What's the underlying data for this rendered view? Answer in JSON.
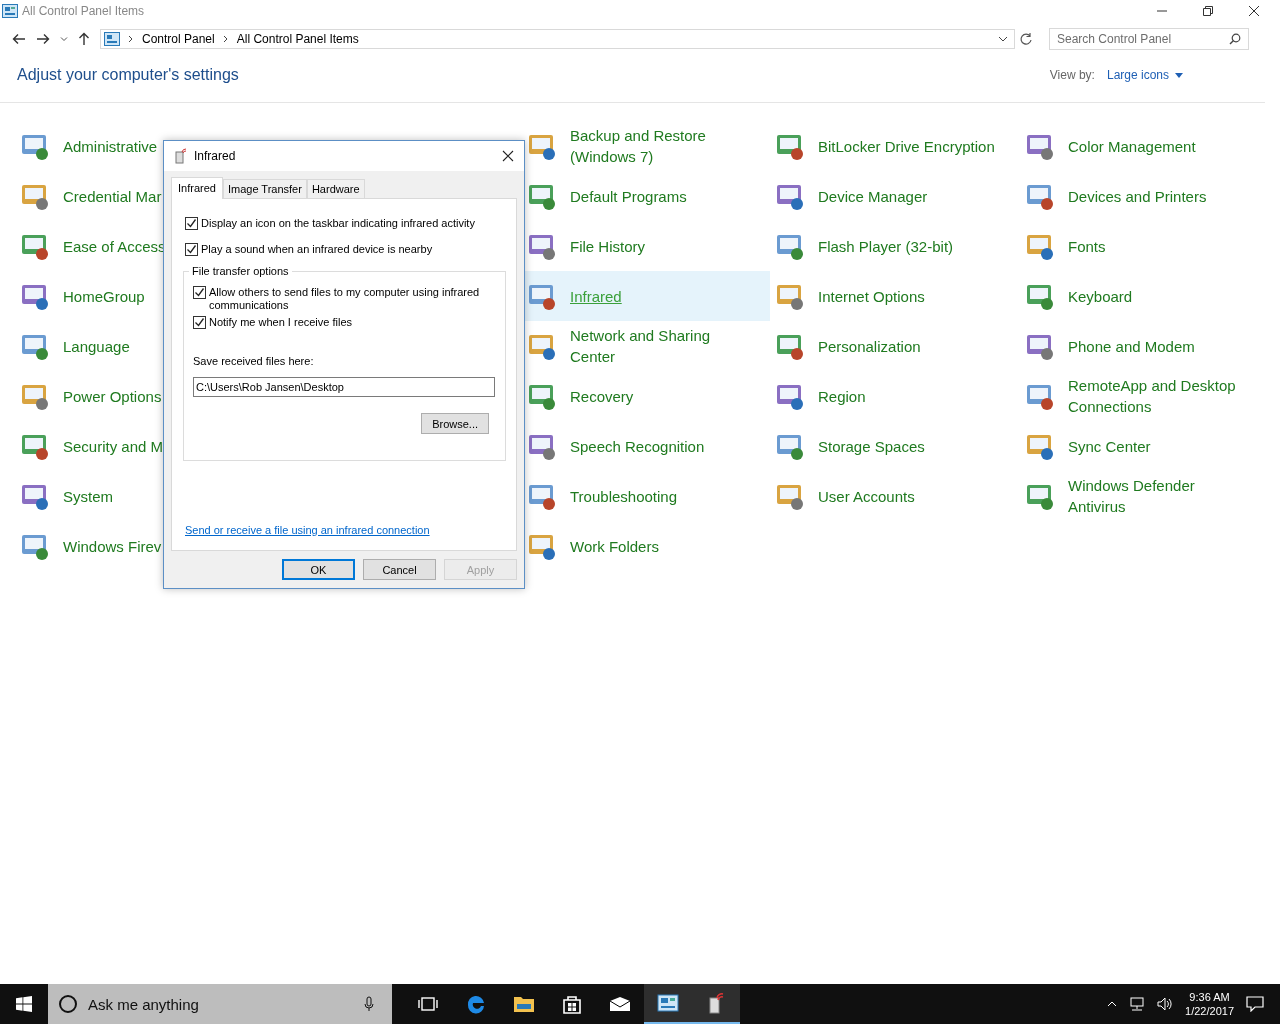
{
  "window": {
    "title": "All Control Panel Items"
  },
  "address": {
    "crumbs": [
      "Control Panel",
      "All Control Panel Items"
    ],
    "search_placeholder": "Search Control Panel"
  },
  "header": {
    "title": "Adjust your computer's settings",
    "view_by_label": "View by:",
    "view_by_value": "Large icons"
  },
  "columns": [
    {
      "items": [
        {
          "label": "Administrative",
          "selected": false
        },
        {
          "label": "Credential Mar",
          "selected": false
        },
        {
          "label": "Ease of Access",
          "selected": false
        },
        {
          "label": "HomeGroup",
          "selected": false
        },
        {
          "label": "Language",
          "selected": false
        },
        {
          "label": "Power Options",
          "selected": false
        },
        {
          "label": "Security and M",
          "selected": false
        },
        {
          "label": "System",
          "selected": false
        },
        {
          "label": "Windows Firev",
          "selected": false
        }
      ]
    },
    {
      "items": [
        {
          "label": "Backup and Restore (Windows 7)",
          "selected": false
        },
        {
          "label": "Default Programs",
          "selected": false
        },
        {
          "label": "File History",
          "selected": false
        },
        {
          "label": "Infrared",
          "selected": true
        },
        {
          "label": "Network and Sharing Center",
          "selected": false
        },
        {
          "label": "Recovery",
          "selected": false
        },
        {
          "label": "Speech Recognition",
          "selected": false
        },
        {
          "label": "Troubleshooting",
          "selected": false
        },
        {
          "label": "Work Folders",
          "selected": false
        }
      ]
    },
    {
      "items": [
        {
          "label": "BitLocker Drive Encryption",
          "selected": false
        },
        {
          "label": "Device Manager",
          "selected": false
        },
        {
          "label": "Flash Player (32-bit)",
          "selected": false
        },
        {
          "label": "Internet Options",
          "selected": false
        },
        {
          "label": "Personalization",
          "selected": false
        },
        {
          "label": "Region",
          "selected": false
        },
        {
          "label": "Storage Spaces",
          "selected": false
        },
        {
          "label": "User Accounts",
          "selected": false
        }
      ]
    },
    {
      "items": [
        {
          "label": "Color Management",
          "selected": false
        },
        {
          "label": "Devices and Printers",
          "selected": false
        },
        {
          "label": "Fonts",
          "selected": false
        },
        {
          "label": "Keyboard",
          "selected": false
        },
        {
          "label": "Phone and Modem",
          "selected": false
        },
        {
          "label": "RemoteApp and Desktop Connections",
          "selected": false
        },
        {
          "label": "Sync Center",
          "selected": false
        },
        {
          "label": "Windows Defender Antivirus",
          "selected": false
        }
      ]
    }
  ],
  "dialog": {
    "title": "Infrared",
    "tabs": [
      {
        "label": "Infrared",
        "selected": true
      },
      {
        "label": "Image Transfer",
        "selected": false
      },
      {
        "label": "Hardware",
        "selected": false
      }
    ],
    "options": [
      {
        "label": "Display an icon on the taskbar indicating infrared activity",
        "checked": true
      },
      {
        "label": "Play a sound when an infrared device is nearby",
        "checked": true
      }
    ],
    "group": {
      "title": "File transfer options",
      "options": [
        {
          "label": "Allow others to send files to my computer using infrared communications",
          "checked": true
        },
        {
          "label": "Notify me when I receive files",
          "checked": true
        }
      ],
      "save_label": "Save received files here:",
      "save_path": "C:\\Users\\Rob Jansen\\Desktop",
      "browse": "Browse..."
    },
    "link": "Send or receive a file using an infrared connection",
    "buttons": [
      {
        "label": "OK",
        "default": true,
        "disabled": false
      },
      {
        "label": "Cancel",
        "default": false,
        "disabled": false
      },
      {
        "label": "Apply",
        "default": false,
        "disabled": true
      }
    ]
  },
  "taskbar": {
    "search_placeholder": "Ask me anything",
    "apps": [
      {
        "kind": "taskview",
        "open": false
      },
      {
        "kind": "edge",
        "open": false
      },
      {
        "kind": "explorer",
        "open": false
      },
      {
        "kind": "store",
        "open": false
      },
      {
        "kind": "mail",
        "open": false
      },
      {
        "kind": "controlpanel",
        "open": true
      },
      {
        "kind": "infrared",
        "open": true
      }
    ],
    "time": "9:36 AM",
    "date": "1/22/2017"
  }
}
